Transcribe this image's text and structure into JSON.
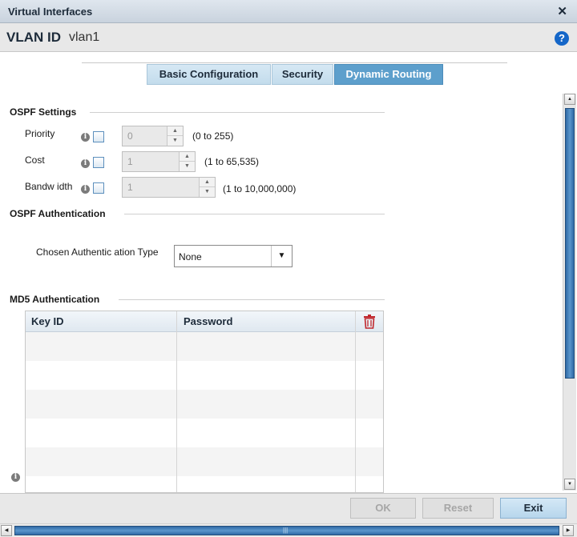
{
  "window": {
    "title": "Virtual Interfaces"
  },
  "header": {
    "vlan_label": "VLAN ID",
    "vlan_value": "vlan1"
  },
  "tabs": [
    {
      "label": "Basic Configuration",
      "active": false
    },
    {
      "label": "Security",
      "active": false
    },
    {
      "label": "Dynamic Routing",
      "active": true
    }
  ],
  "ospf_settings": {
    "title": "OSPF Settings",
    "fields": [
      {
        "label": "Priority",
        "value": "0",
        "range": "(0 to 255)"
      },
      {
        "label": "Cost",
        "value": "1",
        "range": "(1 to 65,535)"
      },
      {
        "label": "Bandw idth",
        "value": "1",
        "range": "(1 to 10,000,000)"
      }
    ]
  },
  "ospf_auth": {
    "title": "OSPF Authentication",
    "type_label": "Chosen Authentic ation Type",
    "type_value": "None"
  },
  "md5_auth": {
    "title": "MD5 Authentication",
    "columns": [
      "Key ID",
      "Password"
    ],
    "rows": []
  },
  "footer": {
    "ok_label": "OK",
    "reset_label": "Reset",
    "exit_label": "Exit"
  },
  "icons": {
    "close": "close-icon",
    "help": "help-icon",
    "info": "info-icon",
    "trash": "trash-icon"
  },
  "colors": {
    "active_tab": "#5d9fcc",
    "help": "#1466c8",
    "trash": "#c0272d",
    "scroll_thumb": "#2f6aa6"
  }
}
